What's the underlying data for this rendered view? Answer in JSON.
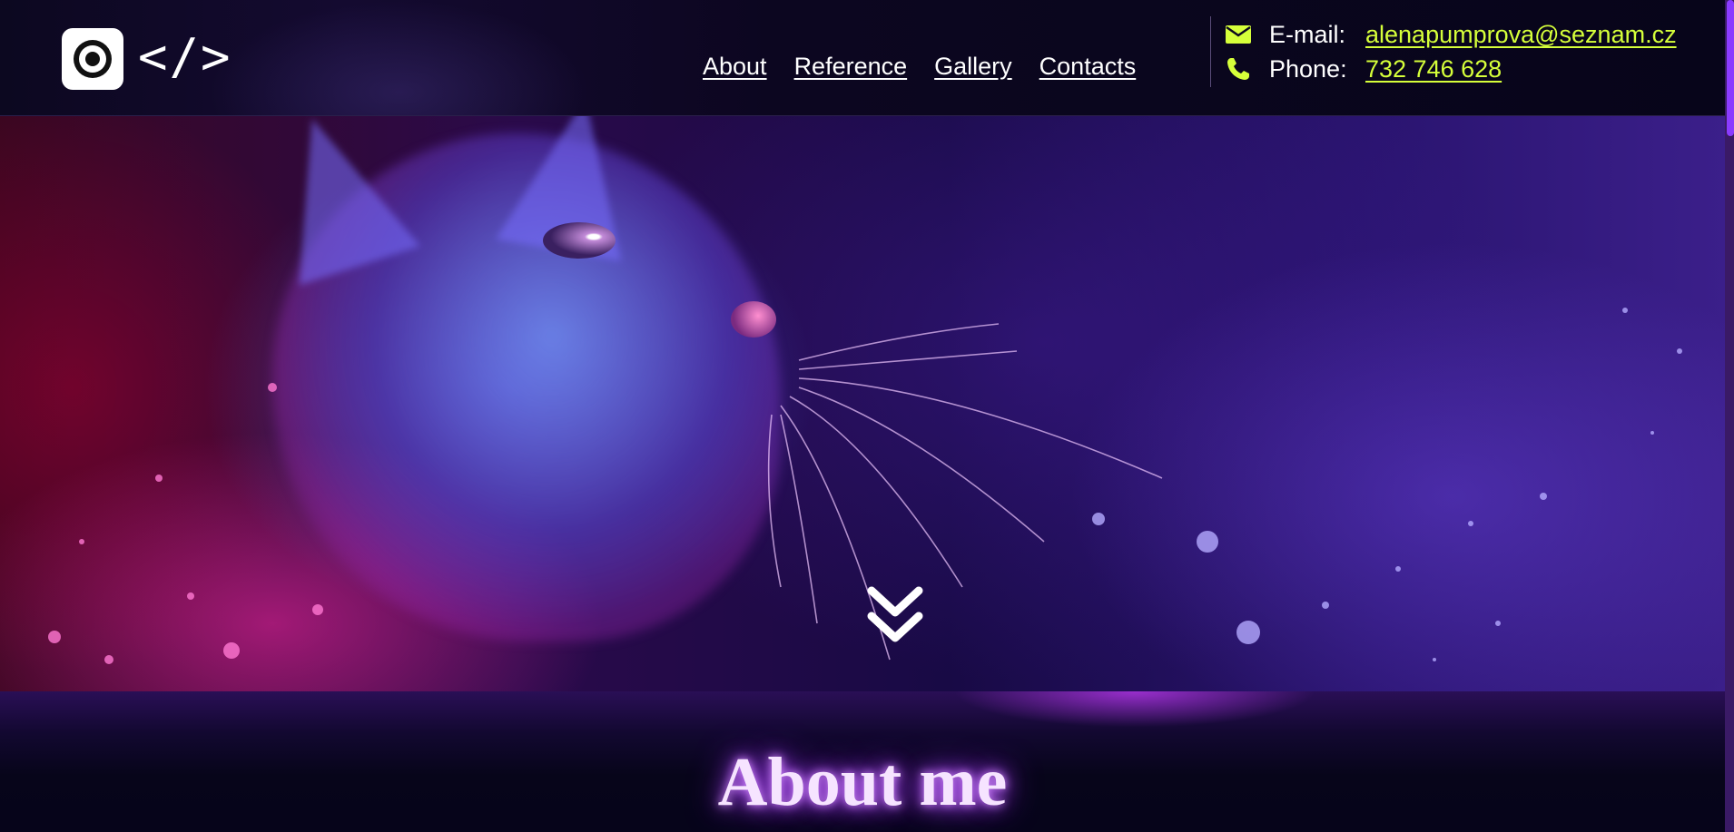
{
  "header": {
    "logo_text": "</>",
    "nav": [
      {
        "label": "About"
      },
      {
        "label": "Reference"
      },
      {
        "label": "Gallery"
      },
      {
        "label": "Contacts"
      }
    ],
    "contact": {
      "email_label": "E-mail:",
      "email_value": "alenapumprova@seznam.cz",
      "phone_label": "Phone:",
      "phone_value": "732 746 628"
    }
  },
  "hero": {
    "image": "neon-cat-illustration",
    "scroll_icon": "double-chevron-down-icon"
  },
  "about": {
    "title": "About me"
  },
  "colors": {
    "background": "#0a0618",
    "accent_link": "#d6ff3a",
    "title_glow": "#b44cff",
    "text": "#ffffff"
  },
  "icons": {
    "email": "envelope-icon",
    "phone": "phone-icon",
    "logo": "camera-lens-icon"
  }
}
